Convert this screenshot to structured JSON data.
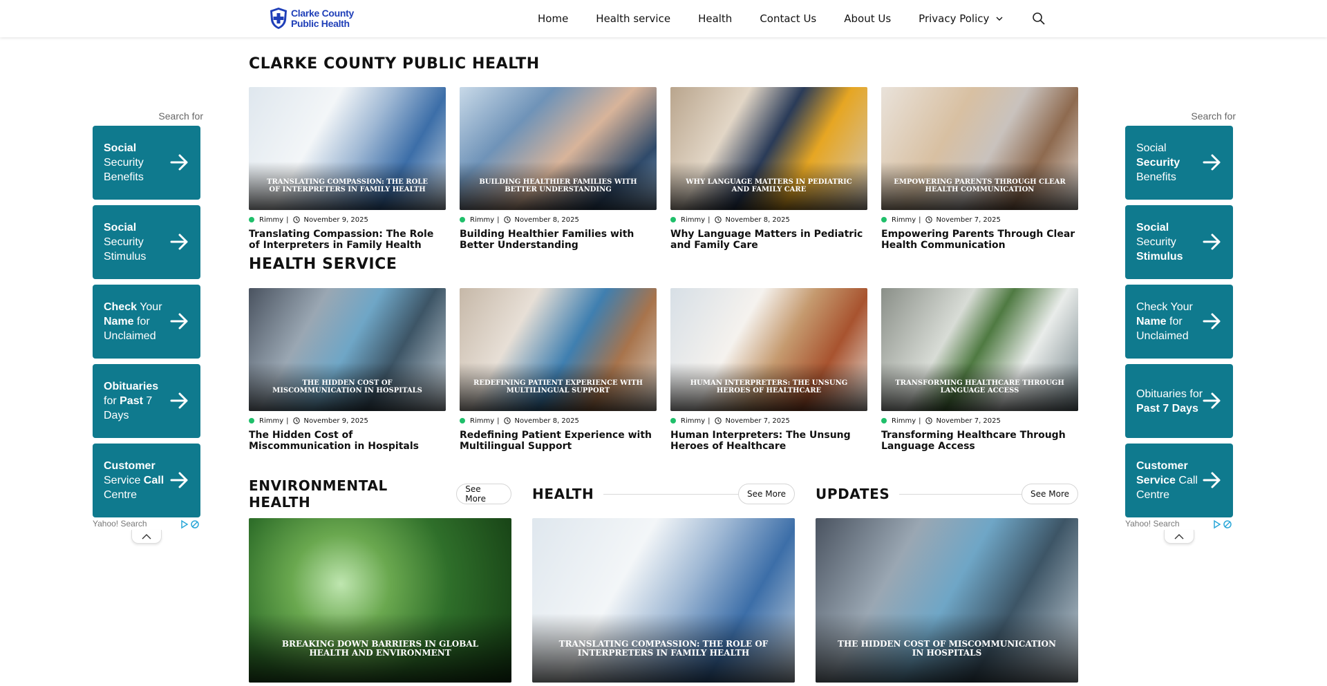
{
  "header": {
    "logo_line1": "Clarke County",
    "logo_line2": "Public Health",
    "nav": [
      "Home",
      "Health service",
      "Health",
      "Contact Us",
      "About Us",
      "Privacy Policy"
    ]
  },
  "ads": {
    "search_label": "Search for",
    "footer_label": "Yahoo! Search",
    "left": [
      {
        "text": "<b>Social</b> Security Benefits"
      },
      {
        "text": "<b>Social</b> Security Stimulus"
      },
      {
        "text": "<b>Check</b> Your <b>Name</b> for Unclaimed"
      },
      {
        "text": "<b>Obituaries</b> for <b>Past</b> 7 Days"
      },
      {
        "text": "<b>Customer</b> Service <b>Call</b> Centre"
      }
    ],
    "right": [
      {
        "text": "Social <b>Security</b> Benefits"
      },
      {
        "text": "<b>Social</b> Security <b>Stimulus</b>"
      },
      {
        "text": "Check Your <b>Name</b> for Unclaimed"
      },
      {
        "text": "Obituaries for <b>Past 7 Days</b>"
      },
      {
        "text": "<b>Customer</b> <b>Service</b> Call Centre"
      }
    ]
  },
  "sections": {
    "top_title": "CLARKE COUNTY PUBLIC HEALTH",
    "top_cards": [
      {
        "caption": "TRANSLATING COMPASSION: THE ROLE OF INTERPRETERS IN FAMILY HEALTH",
        "author": "Rimmy",
        "date": "November 9, 2025",
        "title": "Translating Compassion: The Role of Interpreters in Family Health"
      },
      {
        "caption": "BUILDING HEALTHIER FAMILIES WITH BETTER UNDERSTANDING",
        "author": "Rimmy",
        "date": "November 8, 2025",
        "title": "Building Healthier Families with Better Understanding"
      },
      {
        "caption": "WHY LANGUAGE MATTERS IN PEDIATRIC AND FAMILY CARE",
        "author": "Rimmy",
        "date": "November 8, 2025",
        "title": "Why Language Matters in Pediatric and Family Care"
      },
      {
        "caption": "EMPOWERING PARENTS THROUGH CLEAR HEALTH COMMUNICATION",
        "author": "Rimmy",
        "date": "November 7, 2025",
        "title": "Empowering Parents Through Clear Health Communication"
      }
    ],
    "service_title": "HEALTH SERVICE",
    "service_cards": [
      {
        "caption": "THE HIDDEN COST OF MISCOMMUNICATION IN HOSPITALS",
        "author": "Rimmy",
        "date": "November 9, 2025",
        "title": "The Hidden Cost of Miscommunication in Hospitals"
      },
      {
        "caption": "REDEFINING PATIENT EXPERIENCE WITH MULTILINGUAL SUPPORT",
        "author": "Rimmy",
        "date": "November 8, 2025",
        "title": "Redefining Patient Experience with Multilingual Support"
      },
      {
        "caption": "HUMAN INTERPRETERS: THE UNSUNG HEROES OF HEALTHCARE",
        "author": "Rimmy",
        "date": "November 7, 2025",
        "title": "Human Interpreters: The Unsung Heroes of Healthcare"
      },
      {
        "caption": "TRANSFORMING HEALTHCARE THROUGH LANGUAGE ACCESS",
        "author": "Rimmy",
        "date": "November 7, 2025",
        "title": "Transforming Healthcare Through Language Access"
      }
    ],
    "columns": [
      {
        "title": "ENVIRONMENTAL HEALTH",
        "see_more": "See More",
        "caption": "BREAKING DOWN BARRIERS IN GLOBAL HEALTH AND ENVIRONMENT"
      },
      {
        "title": "HEALTH",
        "see_more": "See More",
        "caption": "TRANSLATING COMPASSION: THE ROLE OF INTERPRETERS IN FAMILY HEALTH"
      },
      {
        "title": "UPDATES",
        "see_more": "See More",
        "caption": "THE HIDDEN COST OF MISCOMMUNICATION IN HOSPITALS"
      }
    ]
  },
  "colors": {
    "accent": "#0f7a8e",
    "dot": "#1fbf6a",
    "logo": "#1f3fb8"
  },
  "icons": [
    "shield-cross-logo",
    "search-icon",
    "chevron-down-icon",
    "arrow-right-icon",
    "clock-icon",
    "adchoices-icon",
    "chevron-up-icon"
  ]
}
